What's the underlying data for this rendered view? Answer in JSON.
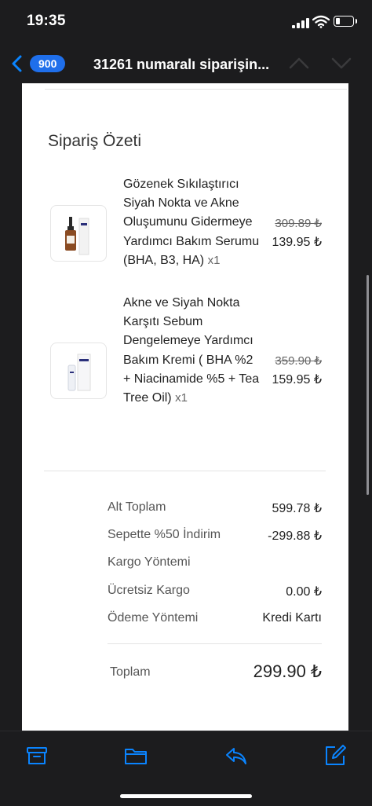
{
  "status_bar": {
    "time": "19:35"
  },
  "nav": {
    "badge": "900",
    "title": "31261 numaralı siparişin..."
  },
  "order": {
    "section_title": "Sipariş Özeti",
    "items": [
      {
        "name": "Gözenek Sıkılaştırıcı Siyah Nokta ve Akne Oluşumunu Gidermeye Yardımcı Bakım Serumu (BHA, B3, HA)",
        "qty": "x1",
        "old_price": "309.89 ₺",
        "price": "139.95 ₺"
      },
      {
        "name": "Akne ve Siyah Nokta Karşıtı Sebum Dengelemeye Yardımcı Bakım Kremi ( BHA %2 + Niacinamide %5 + Tea Tree Oil)",
        "qty": "x1",
        "old_price": "359.90 ₺",
        "price": "159.95 ₺"
      }
    ]
  },
  "summary": {
    "rows": [
      {
        "label": "Alt Toplam",
        "value": "599.78 ₺"
      },
      {
        "label": "Sepette %50 İndirim",
        "value": "-299.88 ₺"
      },
      {
        "label": "Kargo Yöntemi",
        "value": ""
      },
      {
        "label": "Ücretsiz Kargo",
        "value": "0.00 ₺"
      },
      {
        "label": "Ödeme Yöntemi",
        "value": "Kredi Kartı"
      }
    ],
    "total_label": "Toplam",
    "total_value": "299.90 ₺"
  },
  "toolbar": {
    "icons": [
      "archive-icon",
      "folder-icon",
      "reply-icon",
      "compose-icon"
    ],
    "accent_color": "#0a84ff"
  }
}
